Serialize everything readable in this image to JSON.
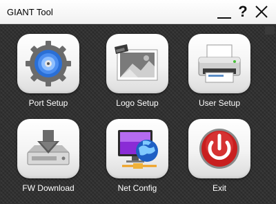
{
  "window": {
    "title": "GIANT Tool",
    "help_glyph": "?"
  },
  "menu": {
    "items": [
      {
        "label": "Port Setup",
        "icon": "gear-disc-icon"
      },
      {
        "label": "Logo Setup",
        "icon": "logo-image-icon"
      },
      {
        "label": "User Setup",
        "icon": "printer-icon"
      },
      {
        "label": "FW Download",
        "icon": "download-drive-icon"
      },
      {
        "label": "Net Config",
        "icon": "network-monitor-icon"
      },
      {
        "label": "Exit",
        "icon": "power-icon"
      }
    ]
  },
  "colors": {
    "background": "#2e2e2e",
    "tile": "#f3f3f3",
    "label": "#ffffff",
    "exit_red": "#c81e1e",
    "disc_blue": "#2a6fd6"
  }
}
